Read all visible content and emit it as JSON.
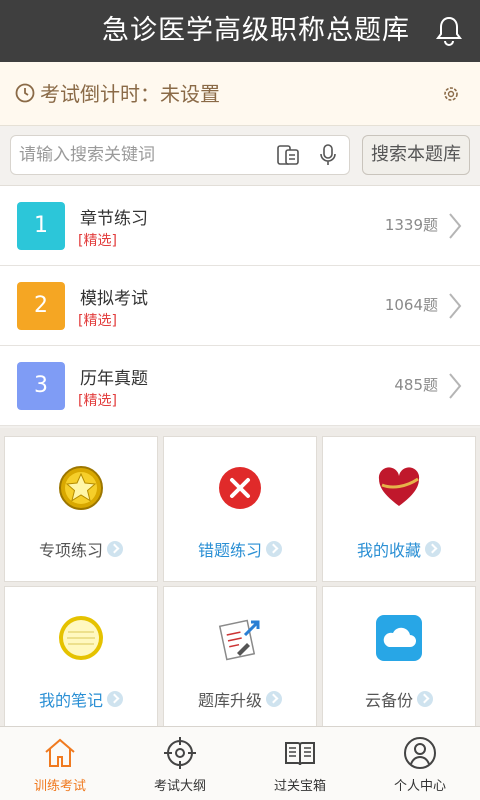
{
  "header": {
    "title": "急诊医学高级职称总题库",
    "bell_icon": "bell-icon"
  },
  "countdown": {
    "text": "考试倒计时：未设置",
    "icon": "timer-icon",
    "settings_icon": "gear-icon"
  },
  "search": {
    "placeholder": "请输入搜索关键词",
    "value": "",
    "button_label": "搜索本题库",
    "scan_icon": "scan-icon",
    "mic_icon": "mic-icon"
  },
  "list": [
    {
      "number": "1",
      "title": "章节练习",
      "tag": "[精选]",
      "count": "1339题",
      "color": "#2cc6d9"
    },
    {
      "number": "2",
      "title": "模拟考试",
      "tag": "[精选]",
      "count": "1064题",
      "color": "#f5a623"
    },
    {
      "number": "3",
      "title": "历年真题",
      "tag": "[精选]",
      "count": "485题",
      "color": "#7f9cf5"
    }
  ],
  "grid": [
    {
      "label": "专项练习",
      "icon": "star-badge-icon",
      "color": "#555555"
    },
    {
      "label": "错题练习",
      "icon": "wrong-x-icon",
      "color": "#2a8fd4"
    },
    {
      "label": "我的收藏",
      "icon": "heart-icon",
      "color": "#2a8fd4"
    },
    {
      "label": "我的笔记",
      "icon": "notebook-icon",
      "color": "#2a8fd4"
    },
    {
      "label": "题库升级",
      "icon": "upgrade-doc-icon",
      "color": "#555555"
    },
    {
      "label": "云备份",
      "icon": "cloud-icon",
      "color": "#555555"
    }
  ],
  "tabs": [
    {
      "label": "训练考试",
      "icon": "home-icon",
      "active": true
    },
    {
      "label": "考试大纲",
      "icon": "target-icon",
      "active": false
    },
    {
      "label": "过关宝箱",
      "icon": "book-icon",
      "active": false
    },
    {
      "label": "个人中心",
      "icon": "user-icon",
      "active": false
    }
  ],
  "colors": {
    "active_tab": "#f07a20",
    "tag_red": "#e23c3c",
    "header_bg": "#3f3f3f"
  }
}
